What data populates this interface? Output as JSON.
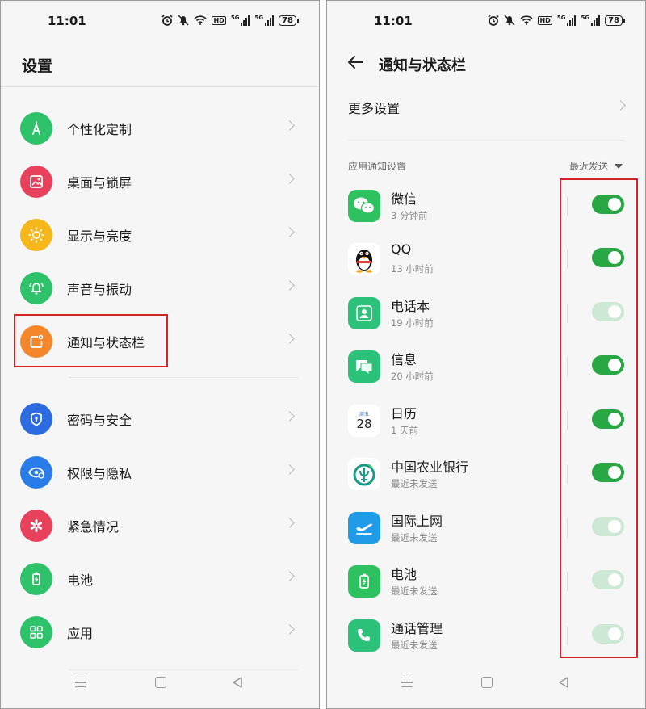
{
  "left": {
    "status": {
      "time": "11:01",
      "battery": "78",
      "hd": "HD",
      "sig": "5G"
    },
    "title": "设置",
    "items": [
      {
        "label": "个性化定制",
        "color": "#2ec26b",
        "icon": "compass-icon"
      },
      {
        "label": "桌面与锁屏",
        "color": "#e8415b",
        "icon": "image-icon"
      },
      {
        "label": "显示与亮度",
        "color": "#f6b71a",
        "icon": "sun-icon"
      },
      {
        "label": "声音与振动",
        "color": "#2ec26b",
        "icon": "bell-icon"
      },
      {
        "label": "通知与状态栏",
        "color": "#f4862b",
        "icon": "notification-icon"
      },
      {
        "label": "密码与安全",
        "color": "#2c6ce0",
        "icon": "shield-icon"
      },
      {
        "label": "权限与隐私",
        "color": "#2a7de8",
        "icon": "eye-icon"
      },
      {
        "label": "紧急情况",
        "color": "#e8415b",
        "icon": "asterisk-icon"
      },
      {
        "label": "电池",
        "color": "#2ec26b",
        "icon": "battery-icon"
      },
      {
        "label": "应用",
        "color": "#2ec26b",
        "icon": "apps-grid-icon"
      }
    ]
  },
  "right": {
    "status": {
      "time": "11:01",
      "battery": "78",
      "hd": "HD",
      "sig": "5G"
    },
    "title": "通知与状态栏",
    "more": "更多设置",
    "section": "应用通知设置",
    "sort": "最近发送",
    "calendar_weekday": "周五",
    "calendar_day": "28",
    "apps": [
      {
        "name": "微信",
        "sub": "3 分钟前",
        "on": true
      },
      {
        "name": "QQ",
        "sub": "13 小时前",
        "on": true
      },
      {
        "name": "电话本",
        "sub": "19 小时前",
        "on": false
      },
      {
        "name": "信息",
        "sub": "20 小时前",
        "on": true
      },
      {
        "name": "日历",
        "sub": "1 天前",
        "on": true
      },
      {
        "name": "中国农业银行",
        "sub": "最近未发送",
        "on": true
      },
      {
        "name": "国际上网",
        "sub": "最近未发送",
        "on": false
      },
      {
        "name": "电池",
        "sub": "最近未发送",
        "on": false
      },
      {
        "name": "通话管理",
        "sub": "最近未发送",
        "on": false
      }
    ]
  },
  "colors": {
    "accent": "#28a745",
    "highlight": "#d62222"
  }
}
